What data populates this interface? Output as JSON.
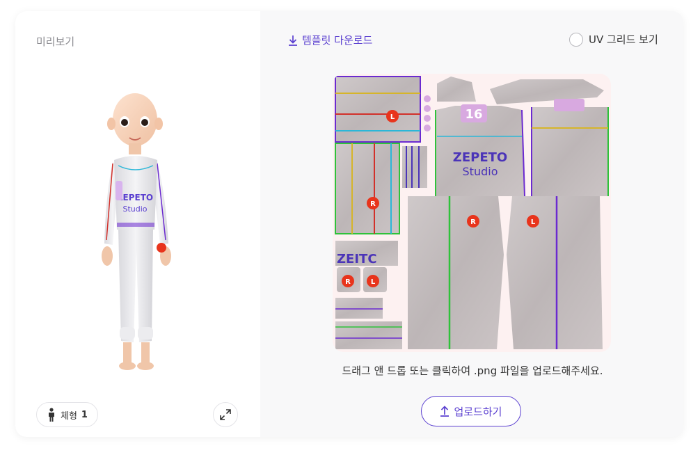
{
  "preview": {
    "title": "미리보기",
    "body_type_label": "체형",
    "body_type_value": "1"
  },
  "editor": {
    "template_download_label": "템플릿 다운로드",
    "uv_grid_label": "UV 그리드 보기",
    "uv_grid_checked": false,
    "hint": "드래그 앤 드롭 또는 클릭하여 .png 파일을 업로드해주세요.",
    "upload_label": "업로드하기"
  },
  "texture": {
    "logo_line1": "ZEPETO",
    "logo_line2": "Studio",
    "sleeve_text": "ZEITC",
    "pocket_number": "16",
    "right_marker": "R",
    "left_marker": "L"
  },
  "colors": {
    "accent": "#5a3fd0",
    "fabric": "#c9c2c3",
    "marker": "#e8341c",
    "seam_purple": "#6b2ad0",
    "seam_green": "#2fc23a",
    "seam_red": "#d2302a",
    "seam_yellow": "#d6b52a",
    "seam_cyan": "#2bb7d8"
  }
}
